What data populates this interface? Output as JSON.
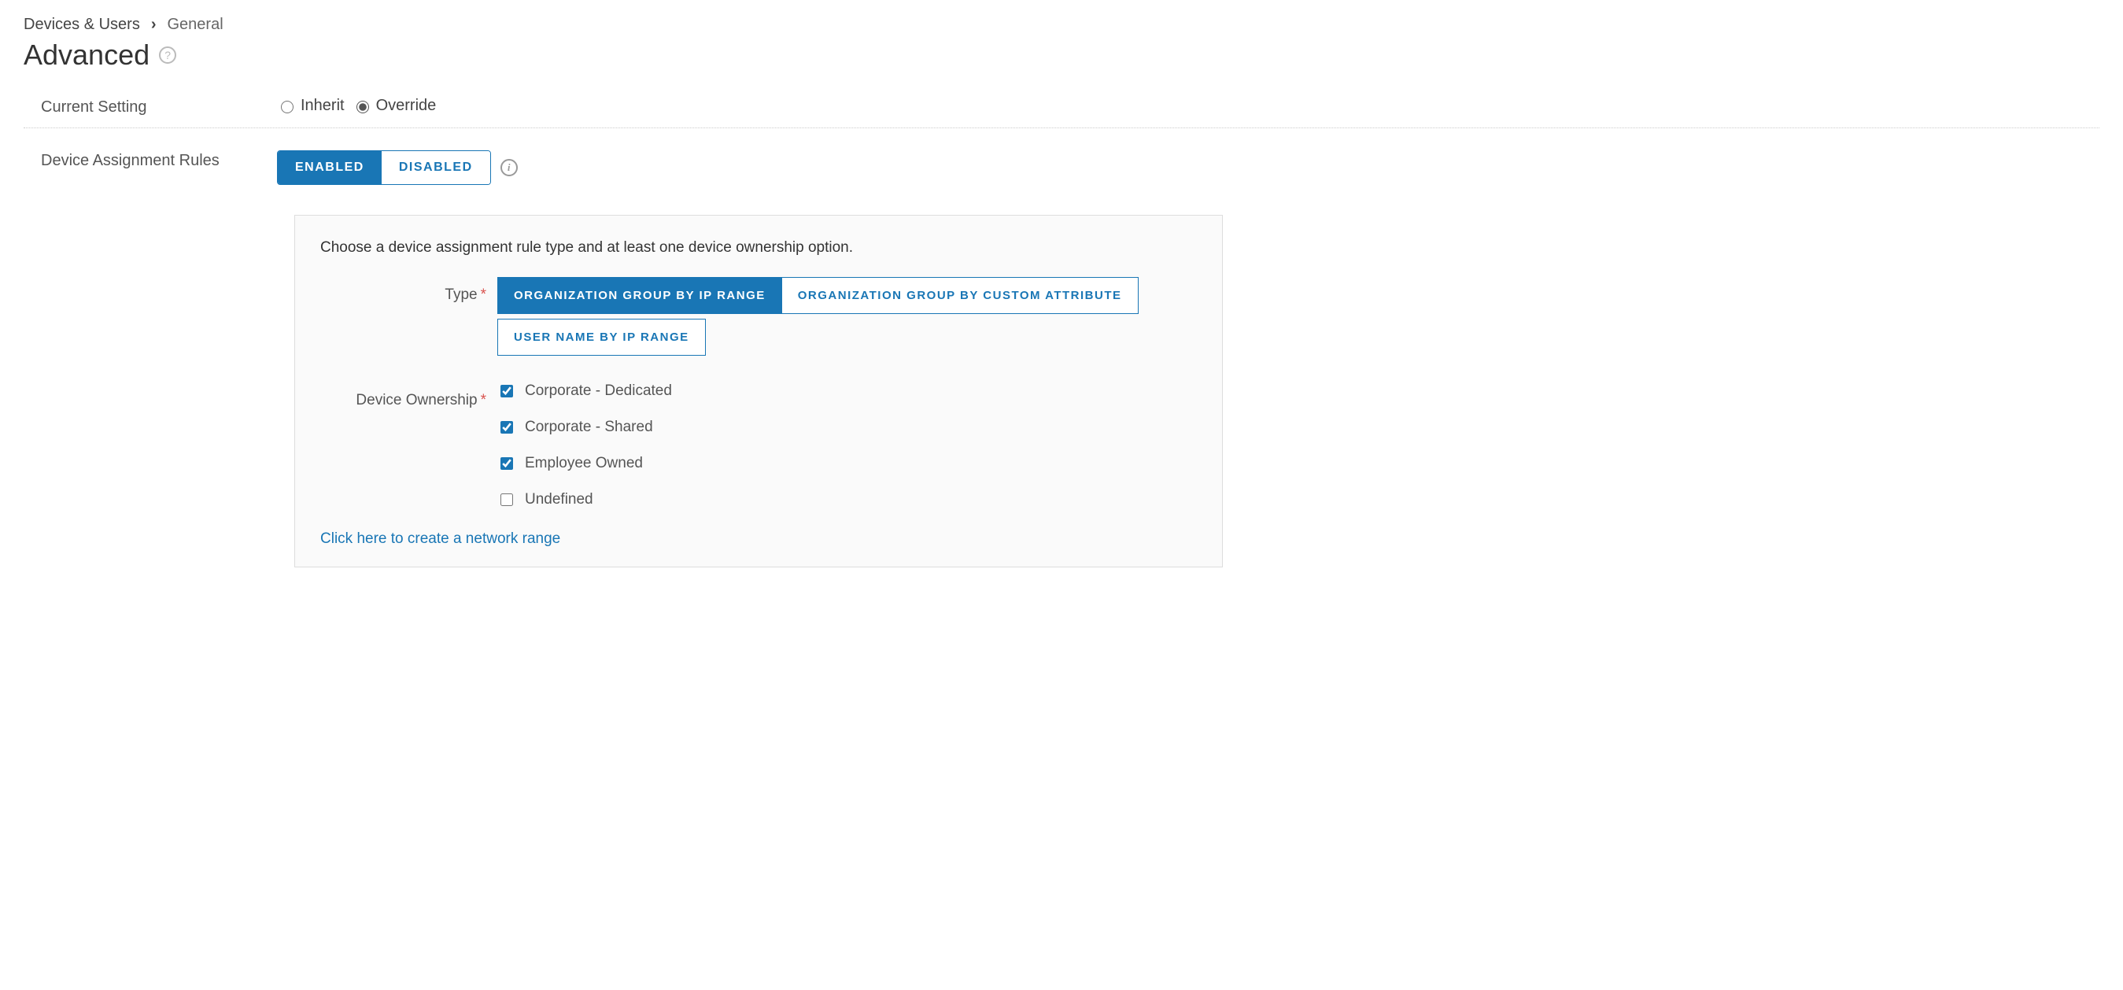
{
  "breadcrumb": {
    "parent": "Devices & Users",
    "current": "General"
  },
  "page_title": "Advanced",
  "settings": {
    "current_setting": {
      "label": "Current Setting",
      "options": {
        "inherit": "Inherit",
        "override": "Override"
      },
      "selected": "override"
    },
    "device_assignment_rules": {
      "label": "Device Assignment Rules",
      "options": {
        "enabled": "ENABLED",
        "disabled": "DISABLED"
      },
      "selected": "enabled"
    }
  },
  "panel": {
    "instruction": "Choose a device assignment rule type and at least one device ownership option.",
    "type": {
      "label": "Type",
      "options": {
        "org_ip": "ORGANIZATION GROUP BY IP RANGE",
        "org_attr": "ORGANIZATION GROUP BY CUSTOM ATTRIBUTE",
        "user_ip": "USER NAME BY IP RANGE"
      },
      "selected": "org_ip"
    },
    "device_ownership": {
      "label": "Device Ownership",
      "options": [
        {
          "label": "Corporate - Dedicated",
          "checked": true
        },
        {
          "label": "Corporate - Shared",
          "checked": true
        },
        {
          "label": "Employee Owned",
          "checked": true
        },
        {
          "label": "Undefined",
          "checked": false
        }
      ]
    },
    "create_link": "Click here to create a network range"
  }
}
